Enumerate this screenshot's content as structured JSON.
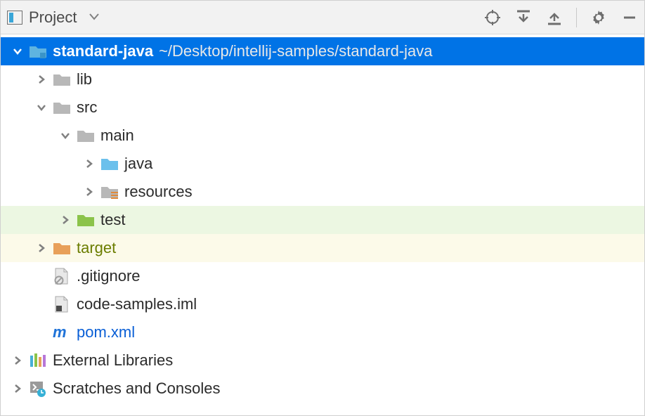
{
  "toolbar": {
    "title": "Project"
  },
  "tree": {
    "project": {
      "name": "standard-java",
      "path": "~/Desktop/intellij-samples/standard-java"
    },
    "lib": "lib",
    "src": "src",
    "main": "main",
    "java": "java",
    "resources": "resources",
    "test": "test",
    "target": "target",
    "gitignore": ".gitignore",
    "iml": "code-samples.iml",
    "pom": "pom.xml",
    "external": "External Libraries",
    "scratches": "Scratches and Consoles"
  }
}
